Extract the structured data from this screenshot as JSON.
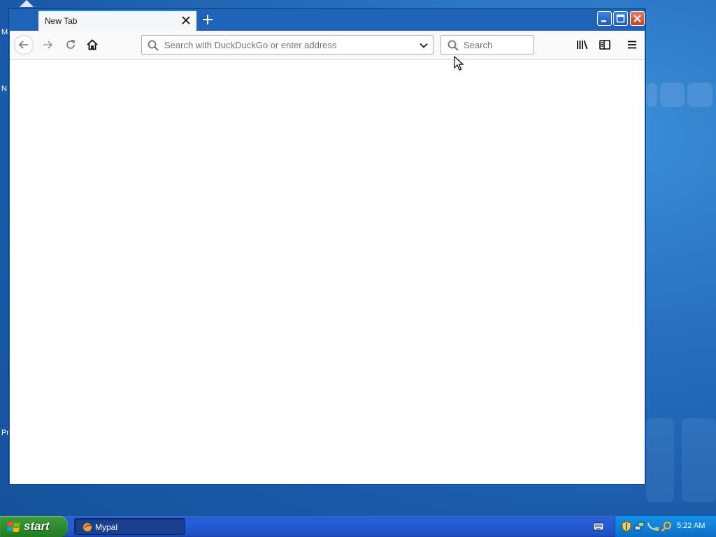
{
  "desktop": {
    "labels": [
      "M",
      "N",
      "Pr"
    ]
  },
  "browser": {
    "tab": {
      "title": "New Tab",
      "close_icon": "close-icon"
    },
    "new_tab_icon": "plus-icon",
    "window_controls": [
      "minimize-icon",
      "maximize-icon",
      "close-icon"
    ],
    "toolbar": {
      "back_icon": "arrow-left-icon",
      "forward_icon": "arrow-right-icon",
      "reload_icon": "reload-icon",
      "home_icon": "home-icon",
      "url_placeholder": "Search with DuckDuckGo or enter address",
      "url_value": "",
      "search_placeholder": "Search",
      "library_icon": "library-icon",
      "sidebar_icon": "sidebar-icon",
      "menu_icon": "hamburger-menu-icon"
    }
  },
  "taskbar": {
    "start_label": "start",
    "task_label": "Mypal",
    "clock": "5:22 AM",
    "tray_icons": [
      "security-shield-icon",
      "network-icon",
      "tray-plug-icon",
      "search-icon"
    ]
  },
  "colors": {
    "desktop": "#2870bf",
    "window_frame": "#1a5fb3",
    "tab_highlight": "#0a84ff",
    "start_button": "#2f8f2f",
    "taskbar": "#245dd7",
    "tray": "#0f81db"
  }
}
